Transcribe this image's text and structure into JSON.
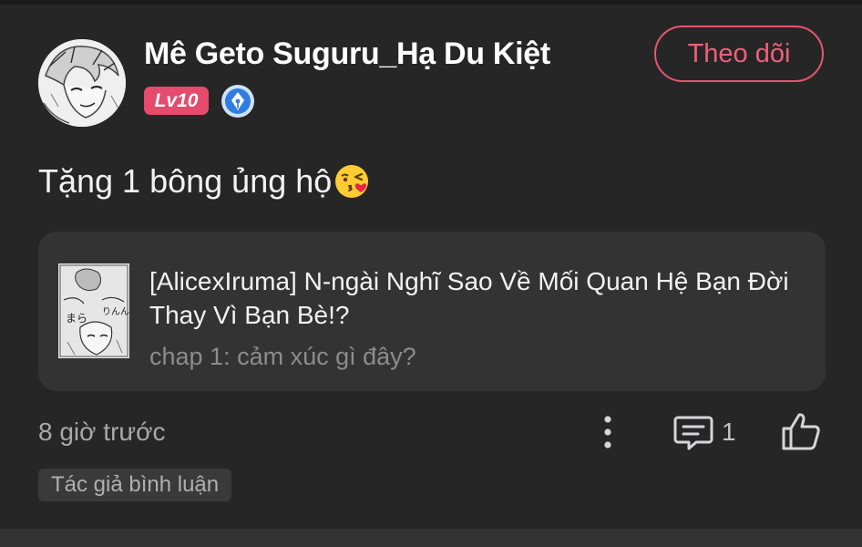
{
  "comment": {
    "username": "Mê Geto Suguru_Hạ Du Kiệt",
    "level_badge": "Lv10",
    "follow_label": "Theo dõi",
    "text": "Tặng 1 bông ủng hộ",
    "emoji": "face-blowing-a-kiss-emoji",
    "timestamp": "8 giờ trước",
    "reply_count": "1",
    "author_tag": "Tác giả bình luận"
  },
  "manga": {
    "title": "[AlicexIruma] N-ngài Nghĩ Sao Về Mối Quan Hệ Bạn Đời Thay Vì Bạn Bè!?",
    "chapter": "chap 1: cảm xúc gì đây?"
  },
  "icons": {
    "rank": "fountain-pen-badge-icon",
    "more": "more-vertical-icon",
    "reply": "comment-icon",
    "like": "thumbs-up-icon"
  },
  "colors": {
    "background": "#262627",
    "card": "#333334",
    "accent": "#e8566f",
    "level_badge": "#e64a6c",
    "rank_badge": "#2f7de1"
  }
}
